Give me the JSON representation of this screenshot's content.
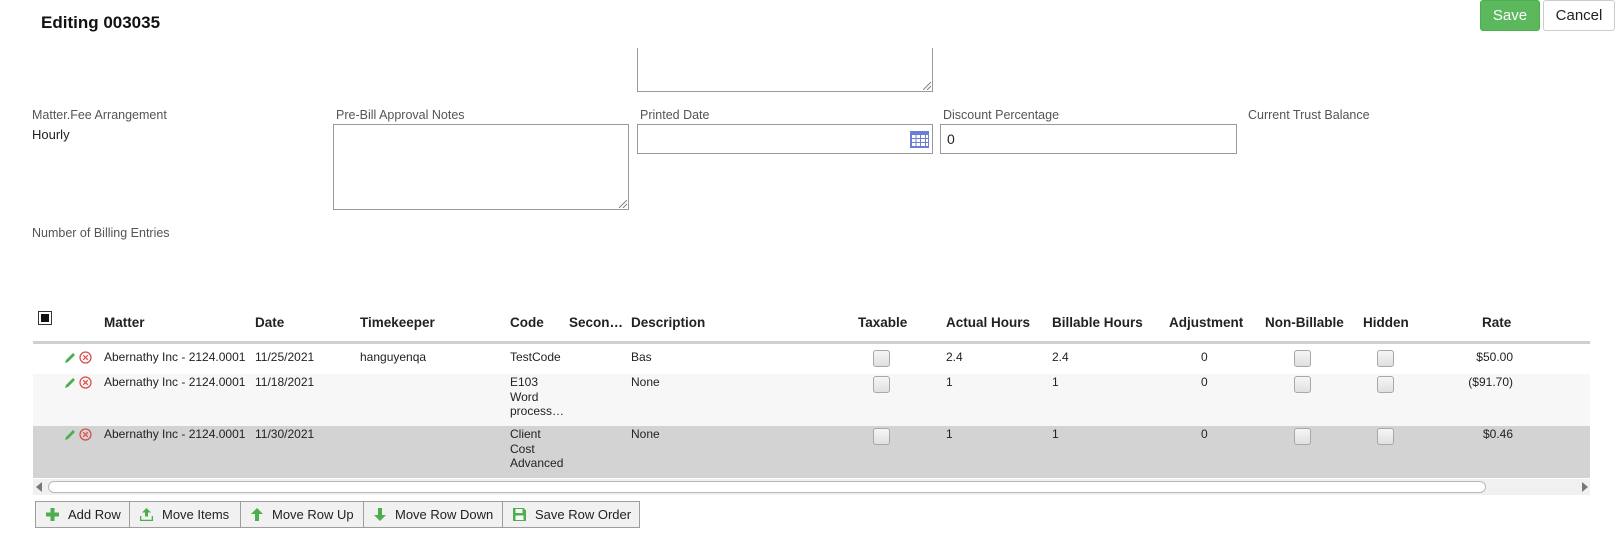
{
  "header": {
    "title": "Editing 003035",
    "save_label": "Save",
    "cancel_label": "Cancel"
  },
  "form": {
    "fee_arrangement_label": "Matter.Fee Arrangement",
    "fee_arrangement_value": "Hourly",
    "prebill_notes_label": "Pre-Bill Approval Notes",
    "prebill_notes_value": "",
    "printed_date_label": "Printed Date",
    "printed_date_value": "",
    "discount_label": "Discount Percentage",
    "discount_value": "0",
    "trust_balance_label": "Current Trust Balance",
    "billing_entries_label": "Number of Billing Entries"
  },
  "table": {
    "columns": {
      "matter": "Matter",
      "date": "Date",
      "timekeeper": "Timekeeper",
      "code": "Code",
      "secondary": "Secon…",
      "description": "Description",
      "taxable": "Taxable",
      "actual_hours": "Actual Hours",
      "billable_hours": "Billable Hours",
      "adjustment": "Adjustment",
      "non_billable": "Non-Billable",
      "hidden": "Hidden",
      "rate": "Rate"
    },
    "rows": [
      {
        "matter": "Abernathy Inc - 2124.0001",
        "date": "11/25/2021",
        "timekeeper": "hanguyenqa",
        "code": [
          "TestCode"
        ],
        "description": "Bas",
        "actual_hours": "2.4",
        "billable_hours": "2.4",
        "adjustment": "0",
        "rate": "$50.00"
      },
      {
        "matter": "Abernathy Inc - 2124.0001",
        "date": "11/18/2021",
        "timekeeper": "",
        "code": [
          "E103",
          "Word",
          "process…"
        ],
        "description": "None",
        "actual_hours": "1",
        "billable_hours": "1",
        "adjustment": "0",
        "rate": "($91.70)"
      },
      {
        "matter": "Abernathy Inc - 2124.0001",
        "date": "11/30/2021",
        "timekeeper": "",
        "code": [
          "Client",
          "Cost",
          "Advanced"
        ],
        "description": "None",
        "actual_hours": "1",
        "billable_hours": "1",
        "adjustment": "0",
        "rate": "$0.46"
      }
    ]
  },
  "toolbar": {
    "add_row": "Add Row",
    "move_items": "Move Items",
    "move_row_up": "Move Row Up",
    "move_row_down": "Move Row Down",
    "save_row_order": "Save Row Order"
  },
  "icons": {
    "edit": "pencil-icon",
    "delete": "remove-circle-icon",
    "calendar": "calendar-icon",
    "add": "plus-icon",
    "move_items": "upload-icon",
    "move_up": "arrow-up-icon",
    "move_down": "arrow-down-icon",
    "save_order": "floppy-disk-icon"
  },
  "colors": {
    "save_button": "#5cb85c",
    "icon_green": "#4cae4c",
    "icon_red": "#d9534f",
    "calendar_blue": "#6a7fd4",
    "selected_row": "#d3d3d3"
  }
}
